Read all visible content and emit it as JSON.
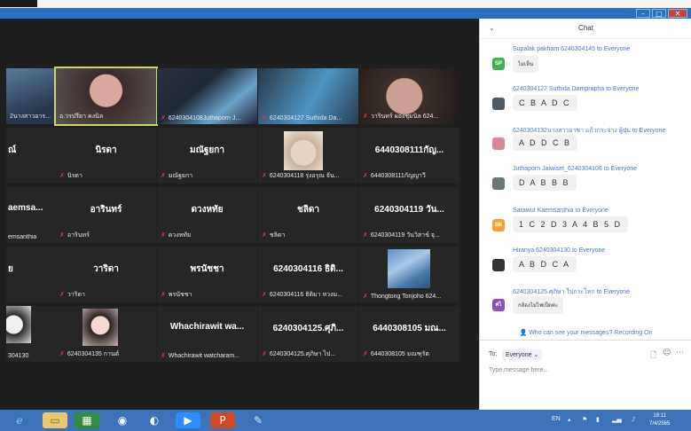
{
  "window": {
    "minimize": "–",
    "maximize": "□",
    "close": "✕"
  },
  "gallery": {
    "tiles": [
      {
        "big": "",
        "cap": "2นางสาวอาร..."
      },
      {
        "big": "",
        "cap": "อ.วรปรียา คงนิล"
      },
      {
        "big": "",
        "cap": "6240304108Juthaporn J..."
      },
      {
        "big": "",
        "cap": "6240304127 Suthida Da..."
      },
      {
        "big": "",
        "cap": "วารินทร์ ผองชุมนิล 624..."
      },
      {
        "big": "ณ์",
        "cap": ""
      },
      {
        "big": "นิรดา",
        "cap": "นิรดา"
      },
      {
        "big": "มณัฐยกา",
        "cap": "มณัฐยกา"
      },
      {
        "big": "",
        "cap": "6240304118 รุ่งอรุณ จัน..."
      },
      {
        "big": "6440308111กัญ...",
        "cap": "6440308111กัญญาวี"
      },
      {
        "big": "aemsa...",
        "cap": "emsanthia"
      },
      {
        "big": "อารินทร์",
        "cap": "อารินทร์"
      },
      {
        "big": "ดวงหทัย",
        "cap": "ดวงหทัย"
      },
      {
        "big": "ชลิดา",
        "cap": "ชลิดา"
      },
      {
        "big": "6240304119 วัน...",
        "cap": "6240304119 วันวิสาข์ จุ..."
      },
      {
        "big": "ย",
        "cap": ""
      },
      {
        "big": "วาริดา",
        "cap": "วาริดา"
      },
      {
        "big": "พรนัชชา",
        "cap": "พรนัชชา"
      },
      {
        "big": "6240304116 ธิติ...",
        "cap": "6240304116 ธิติมา หวงม..."
      },
      {
        "big": "",
        "cap": "Thongtong Tonjoho 624..."
      },
      {
        "big": "",
        "cap": "304130"
      },
      {
        "big": "",
        "cap": "6240304135 กานต์"
      },
      {
        "big": "Whachirawit wa...",
        "cap": "Whachirawit watcharam..."
      },
      {
        "big": "6240304125.ศุภิ...",
        "cap": "6240304125.ศุภิษา ไป..."
      },
      {
        "big": "6440308105 มณ...",
        "cap": "6440308105 มณฑุรัต"
      }
    ]
  },
  "chat": {
    "title": "Chat",
    "messages": [
      {
        "from": "Supalak pakham 6240304145 to Everyone",
        "avatar": "SP",
        "color": "#3bb54a",
        "text": "ไม่เห็น",
        "small": true
      },
      {
        "from": "6240304127 Suthida Damprapha to Everyone",
        "avatar": "",
        "color": "#4d5a63",
        "text": "C B A D C",
        "small": false
      },
      {
        "from": "6240304132นางสาวอาซา แก้วกระจ่าง ผู้ปุ่ม to Everyone",
        "avatar": "",
        "color": "#d98a9a",
        "text": "A D D C B",
        "small": false
      },
      {
        "from": "Juthaporn Jaiwiset_6240304108 to Everyone",
        "avatar": "",
        "color": "#6b7a6e",
        "text": "D A B B B",
        "small": false
      },
      {
        "from": "Sarawut Kaemsanthia to Everyone",
        "avatar": "SK",
        "color": "#f0a33a",
        "text": "1 C 2 D 3 A 4 B 5 D",
        "small": false
      },
      {
        "from": "Hiranya 6240304130 to Everyone",
        "avatar": "",
        "color": "#333333",
        "text": "A B D C A",
        "small": false
      },
      {
        "from": "6240304125.ศุภิษา ไปกระโทก to Everyone",
        "avatar": "ศไ",
        "color": "#8a4fc0",
        "text": "กล้องไม่ไฟเป็ดค่ะ",
        "small": true
      }
    ],
    "who_can_see": "Who can see your messages? Recording On",
    "to_label": "To:",
    "to_value": "Everyone ⌄",
    "placeholder": "Type message here..."
  },
  "taskbar": {
    "lang": "EN",
    "time": "18:11",
    "date": "7/4/2565"
  }
}
